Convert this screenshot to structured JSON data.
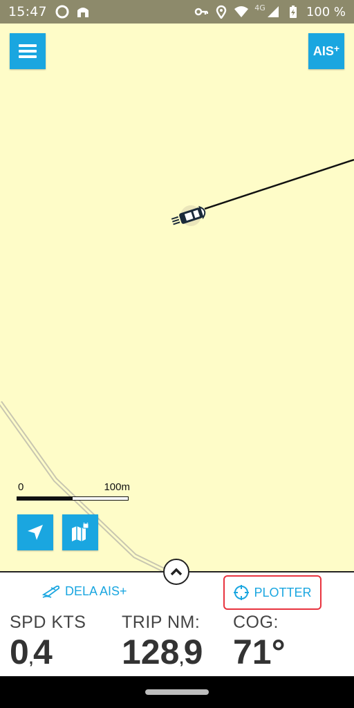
{
  "status_bar": {
    "time": "15:47",
    "battery": "100 %",
    "network": "4G"
  },
  "map": {
    "scale_start": "0",
    "scale_end": "100m",
    "colors": {
      "land": "#fefcc8",
      "button": "#1aa6e0",
      "track": "#111111"
    }
  },
  "header": {
    "ais_label": "AIS",
    "ais_plus": "+"
  },
  "panel": {
    "share_label": "DELA AIS+",
    "plotter_label": "PLOTTER",
    "stats": {
      "spd": {
        "label": "SPD KTS",
        "int": "0",
        "sep": ",",
        "dec": "4"
      },
      "trip": {
        "label": "TRIP NM:",
        "int": "128",
        "sep": ",",
        "dec": "9"
      },
      "cog": {
        "label": "COG:",
        "value": "71°"
      }
    }
  }
}
